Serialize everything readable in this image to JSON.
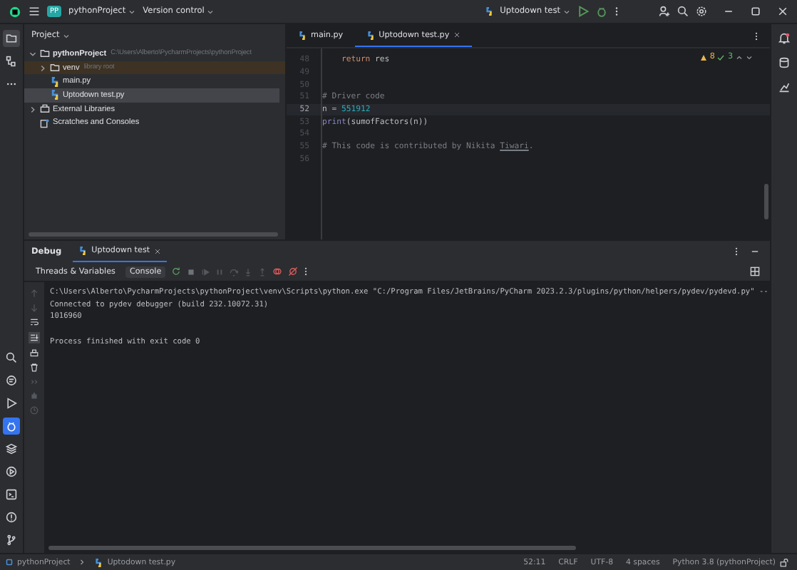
{
  "title_bar": {
    "project_badge": "PP",
    "project": "pythonProject",
    "vcs": "Version control",
    "run_config": "Uptodown test"
  },
  "tool_strip": {
    "top": [
      {
        "kind": "folder",
        "selected": true
      },
      {
        "kind": "structure",
        "selected": false
      },
      {
        "kind": "more",
        "selected": false
      }
    ],
    "bottom": [
      {
        "kind": "search",
        "selected": false
      },
      {
        "kind": "console",
        "selected": false
      },
      {
        "kind": "run",
        "selected": false
      },
      {
        "kind": "debug",
        "selected": true
      },
      {
        "kind": "layers",
        "selected": false
      },
      {
        "kind": "services",
        "selected": false
      },
      {
        "kind": "terminal",
        "selected": false
      },
      {
        "kind": "problems",
        "selected": false
      },
      {
        "kind": "git",
        "selected": false
      }
    ]
  },
  "project_panel": {
    "title": "Project",
    "tree": [
      {
        "label": "pythonProject",
        "path": "C:\\Users\\Alberto\\PycharmProjects\\pythonProject",
        "kind": "folder",
        "expanded": true,
        "selected": false,
        "children": [
          {
            "label": "venv",
            "note": "library root",
            "kind": "folder",
            "expanded": false,
            "selected": false
          },
          {
            "label": "main.py",
            "kind": "python",
            "selected": false
          },
          {
            "label": "Uptodown test.py",
            "kind": "python",
            "selected": true
          }
        ]
      },
      {
        "label": "External Libraries",
        "kind": "library",
        "expanded": false,
        "selected": false
      },
      {
        "label": "Scratches and Consoles",
        "kind": "scratch",
        "selected": false
      }
    ]
  },
  "editor": {
    "tabs": [
      {
        "label": "main.py",
        "selected": false
      },
      {
        "label": "Uptodown test.py",
        "selected": true
      }
    ],
    "warnings": "8",
    "passed": "3",
    "lines": [
      {
        "number": "48",
        "current": false,
        "tokens": [
          {
            "text": "    return",
            "kind": "keyword"
          },
          {
            "text": " res"
          }
        ]
      },
      {
        "number": "49",
        "current": false
      },
      {
        "number": "50",
        "current": false
      },
      {
        "number": "51",
        "current": false,
        "tokens": [
          {
            "text": "# Driver code",
            "kind": "comment"
          }
        ]
      },
      {
        "number": "52",
        "current": true,
        "tokens": [
          {
            "text": "n = "
          },
          {
            "text": "551912",
            "kind": "number"
          }
        ]
      },
      {
        "number": "53",
        "current": false,
        "tokens": [
          {
            "text": "print",
            "kind": "builtin"
          },
          {
            "text": "(sumofFactors(n))"
          }
        ]
      },
      {
        "number": "54",
        "current": false
      },
      {
        "number": "55",
        "current": false,
        "tokens": [
          {
            "text": "# This code is contributed by Nikita ",
            "kind": "comment"
          },
          {
            "text": "Tiwari",
            "kind": "typo"
          },
          {
            "text": ".",
            "kind": "comment"
          }
        ]
      },
      {
        "number": "56",
        "current": false
      }
    ]
  },
  "debug": {
    "title": "Debug",
    "session": "Uptodown test",
    "subtabs": [
      {
        "label": "Threads & Variables",
        "selected": false
      },
      {
        "label": "Console",
        "selected": true
      }
    ],
    "console": [
      {
        "text": "C:\\Users\\Alberto\\PycharmProjects\\pythonProject\\venv\\Scripts\\python.exe \"C:/Program Files/JetBrains/PyCharm 2023.2.3/plugins/python/helpers/pydev/pydevd.py\" --",
        "kind": "output"
      },
      {
        "text": "Connected to pydev debugger (build 232.10072.31)",
        "kind": "output"
      },
      {
        "text": "1016960",
        "kind": "output"
      },
      {
        "text": "Process finished with exit code 0",
        "kind": "status"
      }
    ]
  },
  "status_bar": {
    "breadcrumbs": [
      "pythonProject",
      "Uptodown test.py"
    ],
    "items": [
      "52:11",
      "CRLF",
      "UTF-8",
      "4 spaces",
      "Python 3.8 (pythonProject)"
    ]
  }
}
